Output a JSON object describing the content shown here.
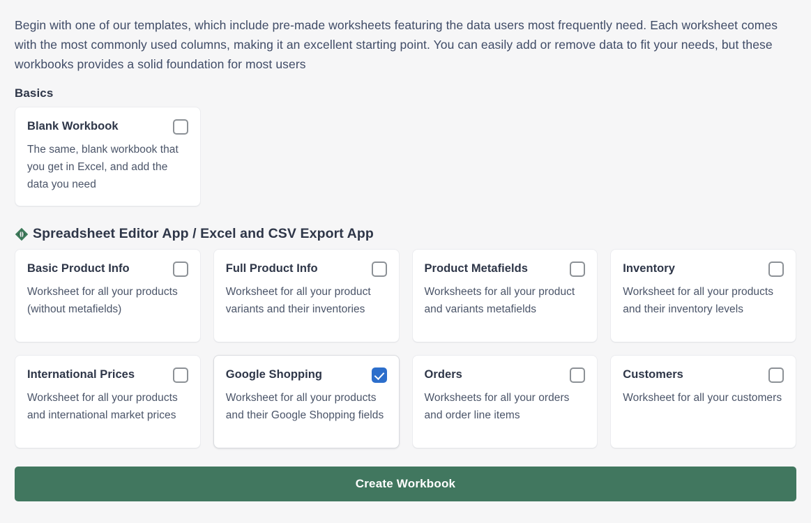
{
  "intro": {
    "paragraph": "Begin with one of our templates, which include pre-made worksheets featuring the data users most frequently need. Each worksheet comes with the most commonly used columns, making it an excellent starting point. You can easily add or remove data to fit your needs, but these workbooks provides a solid foundation for most users"
  },
  "basics": {
    "title": "Basics",
    "cards": [
      {
        "title": "Blank Workbook",
        "description": "The same, blank workbook that you get in Excel, and add the data you need",
        "checked": false
      }
    ]
  },
  "app_section": {
    "icon": "diamond-icon",
    "icon_color": "#3d7a5a",
    "title": "Spreadsheet Editor App / Excel and CSV Export App",
    "row1": [
      {
        "title": "Basic Product Info",
        "description": "Worksheet for all your products (without metafields)",
        "checked": false
      },
      {
        "title": "Full Product Info",
        "description": "Worksheet for all your product variants and their inventories",
        "checked": false
      },
      {
        "title": "Product Metafields",
        "description": "Worksheets for all your product and variants metafields",
        "checked": false
      },
      {
        "title": "Inventory",
        "description": "Worksheet for all your products and their inventory levels",
        "checked": false
      }
    ],
    "row2": [
      {
        "title": "International Prices",
        "description": "Worksheet for all your products and international market prices",
        "checked": false
      },
      {
        "title": "Google Shopping",
        "description": "Worksheet for all your products and their Google Shopping fields",
        "checked": true
      },
      {
        "title": "Orders",
        "description": "Worksheets for all your orders and order line items",
        "checked": false
      },
      {
        "title": "Customers",
        "description": "Worksheet for all your customers",
        "checked": false
      }
    ]
  },
  "footer": {
    "create_label": "Create Workbook",
    "create_color": "#41775f"
  },
  "colors": {
    "background": "#f6f6f7",
    "card_background": "#ffffff",
    "heading_text": "#2e3648",
    "body_text": "#4a5468",
    "checkbox_checked": "#2c6ecb",
    "checkbox_border": "#8c9196"
  }
}
